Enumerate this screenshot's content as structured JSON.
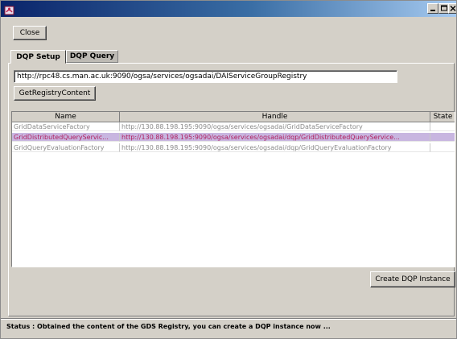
{
  "window": {
    "close_label": "Close",
    "minimize_glyph": "_",
    "maximize_glyph": "□",
    "close_glyph": "x"
  },
  "tabs": [
    {
      "label": "DQP Setup",
      "active": true
    },
    {
      "label": "DQP Query",
      "active": false
    }
  ],
  "registry": {
    "url_value": "http://rpc48.cs.man.ac.uk:9090/ogsa/services/ogsadai/DAIServiceGroupRegistry",
    "get_button_label": "GetRegistryContent"
  },
  "table": {
    "columns": [
      "Name",
      "Handle",
      "State"
    ],
    "rows": [
      {
        "name": "GridDataServiceFactory",
        "handle": "http://130.88.198.195:9090/ogsa/services/ogsadai/GridDataServiceFactory",
        "state": "",
        "selected": false
      },
      {
        "name": "GridDistributedQueryServic...",
        "handle": "http://130.88.198.195:9090/ogsa/services/ogsadai/dqp/GridDistributedQueryService...",
        "state": "",
        "selected": true
      },
      {
        "name": "GridQueryEvaluationFactory",
        "handle": "http://130.88.198.195:9090/ogsa/services/ogsadai/dqp/GridQueryEvaluationFactory",
        "state": "",
        "selected": false
      }
    ]
  },
  "create_button_label": "Create DQP Instance",
  "status_text": "Status : Obtained the content of the GDS Registry, you can create a DQP instance now ...",
  "colors": {
    "titlebar_start": "#0a246a",
    "titlebar_end": "#a6caf0",
    "selected_row_bg": "#c8b6e0",
    "selected_row_text": "#b02060"
  },
  "icons": [
    "java-app-icon",
    "minimize-icon",
    "maximize-icon",
    "close-icon"
  ]
}
